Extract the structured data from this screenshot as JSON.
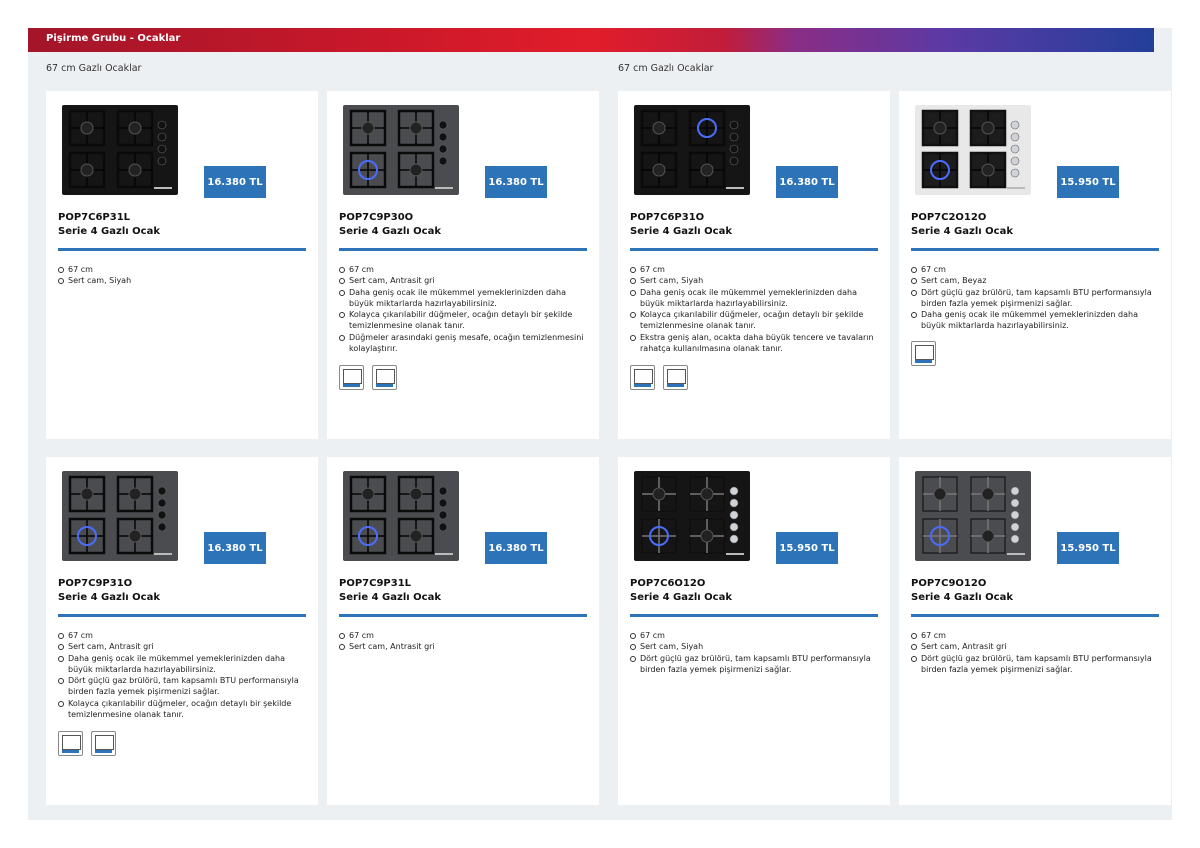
{
  "header": {
    "title": "Pişirme Grubu - Ocaklar"
  },
  "sections": [
    {
      "label": "67 cm Gazlı Ocaklar"
    },
    {
      "label": "67 cm Gazlı Ocaklar"
    }
  ],
  "products": [
    {
      "model": "POP7C6P31L",
      "series": "Serie 4 Gazlı Ocak",
      "price": "16.380 TL",
      "features": [
        "67 cm",
        "Sert cam, Siyah"
      ],
      "badges": 0
    },
    {
      "model": "POP7C9P30O",
      "series": "Serie 4 Gazlı Ocak",
      "price": "16.380 TL",
      "features": [
        "67 cm",
        "Sert cam, Antrasit gri",
        "Daha geniş ocak ile mükemmel yemeklerinizden daha büyük miktarlarda hazırlayabilirsiniz.",
        "Kolayca çıkarılabilir düğmeler, ocağın detaylı bir şekilde temizlenmesine olanak tanır.",
        "Düğmeler arasındaki geniş mesafe, ocağın temizlenmesini kolaylaştırır."
      ],
      "badges": 2
    },
    {
      "model": "POP7C6P31O",
      "series": "Serie 4 Gazlı Ocak",
      "price": "16.380 TL",
      "features": [
        "67 cm",
        "Sert cam, Siyah",
        "Daha geniş ocak ile mükemmel yemeklerinizden daha büyük miktarlarda hazırlayabilirsiniz.",
        "Kolayca çıkarılabilir düğmeler, ocağın detaylı bir şekilde temizlenmesine olanak tanır.",
        "Ekstra geniş alan, ocakta daha büyük tencere ve tavaların rahatça kullanılmasına olanak tanır."
      ],
      "badges": 2
    },
    {
      "model": "POP7C2O12O",
      "series": "Serie 4 Gazlı Ocak",
      "price": "15.950 TL",
      "features": [
        "67 cm",
        "Sert cam, Beyaz",
        "Dört güçlü gaz brülörü, tam kapsamlı BTU performansıyla birden fazla yemek pişirmenizi sağlar.",
        "Daha geniş ocak ile mükemmel yemeklerinizden daha büyük miktarlarda hazırlayabilirsiniz."
      ],
      "badges": 1
    },
    {
      "model": "POP7C9P31O",
      "series": "Serie 4 Gazlı Ocak",
      "price": "16.380 TL",
      "features": [
        "67 cm",
        "Sert cam, Antrasit gri",
        "Daha geniş ocak ile mükemmel yemeklerinizden daha büyük miktarlarda hazırlayabilirsiniz.",
        "Dört güçlü gaz brülörü, tam kapsamlı BTU performansıyla birden fazla yemek pişirmenizi sağlar.",
        "Kolayca çıkarılabilir düğmeler, ocağın detaylı bir şekilde temizlenmesine olanak tanır."
      ],
      "badges": 2
    },
    {
      "model": "POP7C9P31L",
      "series": "Serie 4 Gazlı Ocak",
      "price": "16.380 TL",
      "features": [
        "67 cm",
        "Sert cam, Antrasit gri"
      ],
      "badges": 0
    },
    {
      "model": "POP7C6O12O",
      "series": "Serie 4 Gazlı Ocak",
      "price": "15.950 TL",
      "features": [
        "67 cm",
        "Sert cam, Siyah",
        "Dört güçlü gaz brülörü, tam kapsamlı BTU performansıyla birden fazla yemek pişirmenizi sağlar."
      ],
      "badges": 0
    },
    {
      "model": "POP7C9O12O",
      "series": "Serie 4 Gazlı Ocak",
      "price": "15.950 TL",
      "features": [
        "67 cm",
        "Sert cam, Antrasit gri",
        "Dört güçlü gaz brülörü, tam kapsamlı BTU performansıyla birden fazla yemek pişirmenizi sağlar."
      ],
      "badges": 0
    }
  ],
  "colors": {
    "accent": "#2d73b8",
    "glass_black": "#151515",
    "glass_grey": "#4a4c50",
    "glass_white": "#e8e8e8"
  }
}
